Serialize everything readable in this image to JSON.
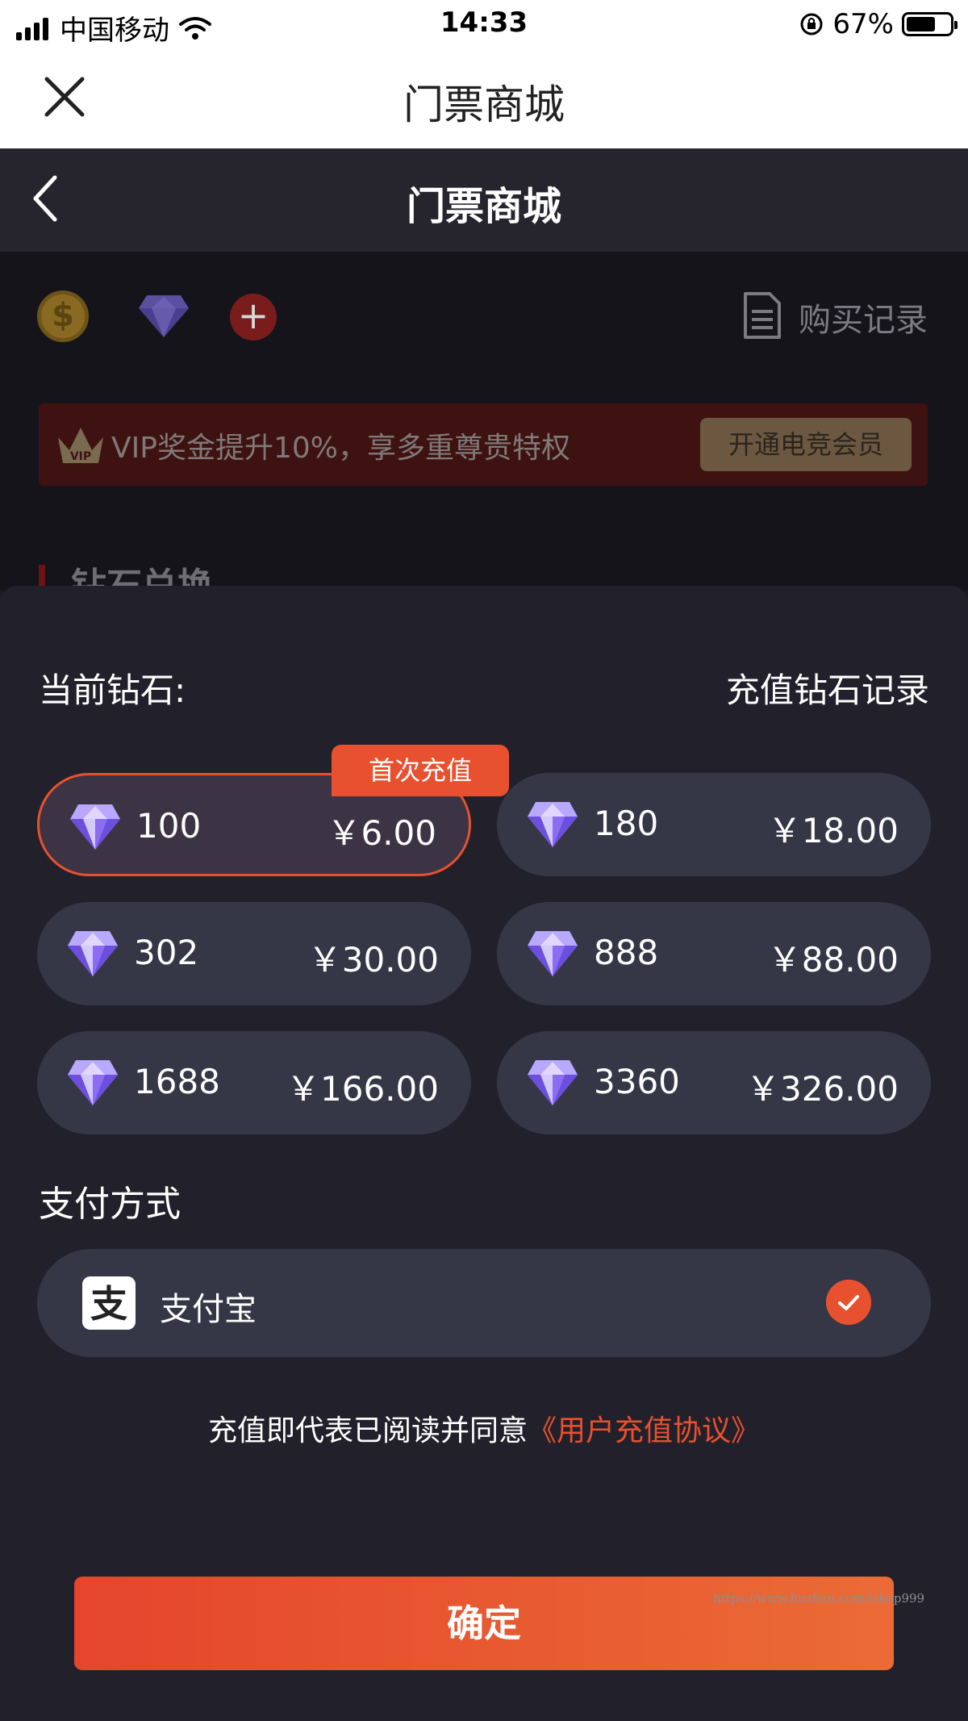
{
  "status_bar": {
    "carrier": "中国移动",
    "time": "14:33",
    "battery": "67%",
    "battery_level": 0.67
  },
  "web_header": {
    "title": "门票商城"
  },
  "app_nav": {
    "title": "门票商城"
  },
  "background_page": {
    "coin_symbol": "$",
    "plus_symbol": "+",
    "purchase_record": "购买记录",
    "vip_badge": "VIP",
    "vip_text": "VIP奖金提升10%，享多重尊贵特权",
    "vip_button": "开通电竞会员",
    "section_title": "钻石兑换"
  },
  "sheet": {
    "current_diamond_label": "当前钻石:",
    "recharge_record": "充值钻石记录",
    "first_recharge_badge": "首次充值",
    "options": [
      {
        "amount": "100",
        "price": "￥6.00"
      },
      {
        "amount": "180",
        "price": "￥18.00"
      },
      {
        "amount": "302",
        "price": "￥30.00"
      },
      {
        "amount": "888",
        "price": "￥88.00"
      },
      {
        "amount": "1688",
        "price": "￥166.00"
      },
      {
        "amount": "3360",
        "price": "￥326.00"
      }
    ],
    "payment_title": "支付方式",
    "payment_method": "支付宝",
    "alipay_glyph": "支",
    "agreement_text": "充值即代表已阅读并同意",
    "agreement_link": "《用户充值协议》",
    "confirm_button": "确定",
    "watermark": "https://www.huzhan.com/ishop999"
  },
  "colors": {
    "accent": "#e8512f",
    "sheet_bg": "#22212b",
    "option_bg": "#363746"
  }
}
